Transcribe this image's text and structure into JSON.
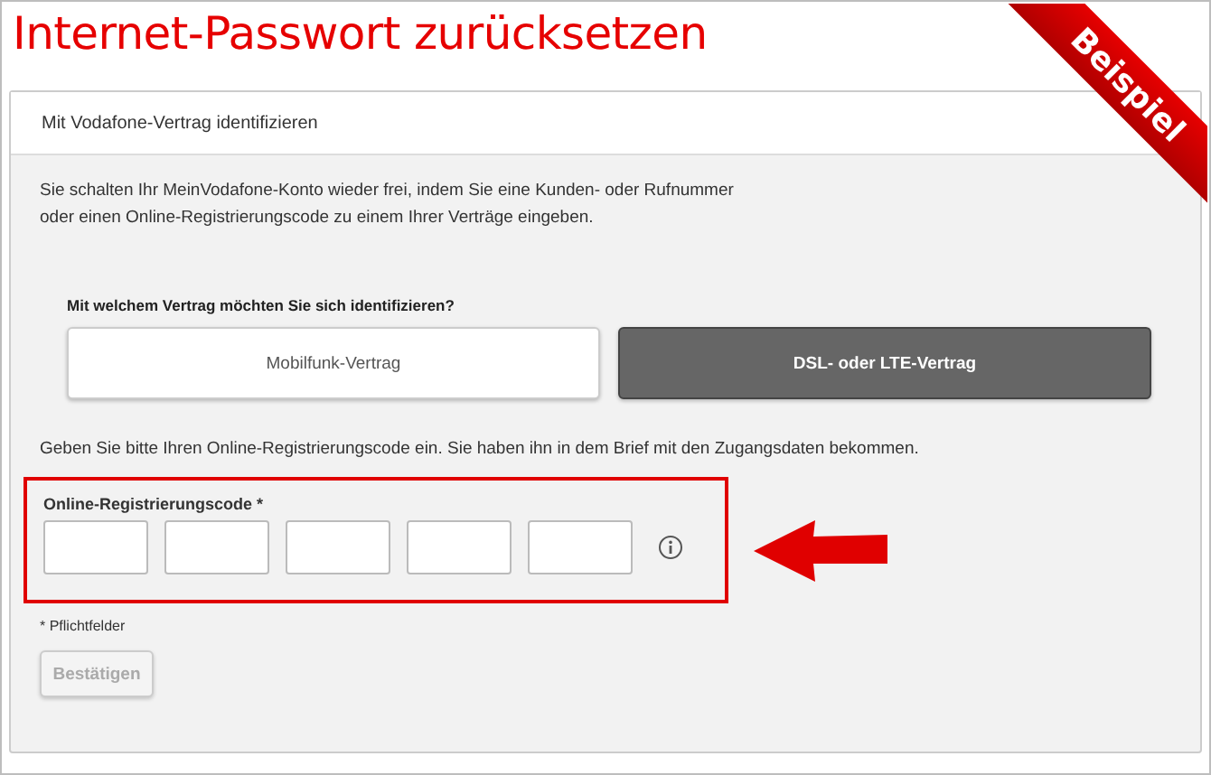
{
  "page": {
    "title": "Internet-Passwort zurücksetzen",
    "ribbon": "Beispiel"
  },
  "card": {
    "header": "Mit Vodafone-Vertrag identifizieren",
    "intro": "Sie schalten Ihr MeinVodafone-Konto wieder frei, indem Sie eine Kunden- oder Rufnummer\noder einen Online-Registrierungscode zu einem Ihrer Verträge eingeben.",
    "question": "Mit welchem Vertrag möchten Sie sich identifizieren?",
    "contract_options": [
      {
        "label": "Mobilfunk-Vertrag",
        "selected": false
      },
      {
        "label": "DSL- oder LTE-Vertrag",
        "selected": true
      }
    ],
    "instruction": "Geben Sie bitte Ihren Online-Registrierungscode ein. Sie haben ihn in dem Brief mit den Zugangsdaten bekommen.",
    "code_field": {
      "label": "Online-Registrierungscode *",
      "highlighted": true,
      "segments": [
        {
          "kind": "text"
        },
        {
          "kind": "text"
        },
        {
          "kind": "text"
        },
        {
          "kind": "text"
        },
        {
          "kind": "text"
        }
      ]
    },
    "required_note": "* Pflichtfelder",
    "submit": {
      "label": "Bestätigen",
      "disabled": true
    }
  }
}
